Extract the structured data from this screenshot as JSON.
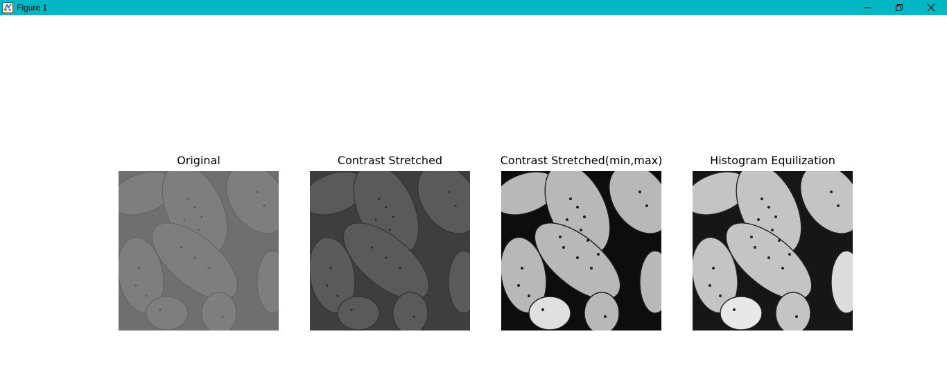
{
  "window": {
    "title": "Figure 1",
    "titlebar_color": "#00b7c3",
    "controls": {
      "minimize_icon": "minimize-icon",
      "restore_icon": "restore-icon",
      "close_icon": "close-icon"
    }
  },
  "figure": {
    "subplots": [
      {
        "title": "Original",
        "image": "seed-pollen-grayscale",
        "contrast": "low"
      },
      {
        "title": "Contrast Stretched",
        "image": "seed-pollen-grayscale",
        "contrast": "low-dark"
      },
      {
        "title": "Contrast Stretched(min,max)",
        "image": "seed-pollen-grayscale",
        "contrast": "high"
      },
      {
        "title": "Histogram Equilization",
        "image": "seed-pollen-grayscale",
        "contrast": "equalized"
      }
    ]
  }
}
